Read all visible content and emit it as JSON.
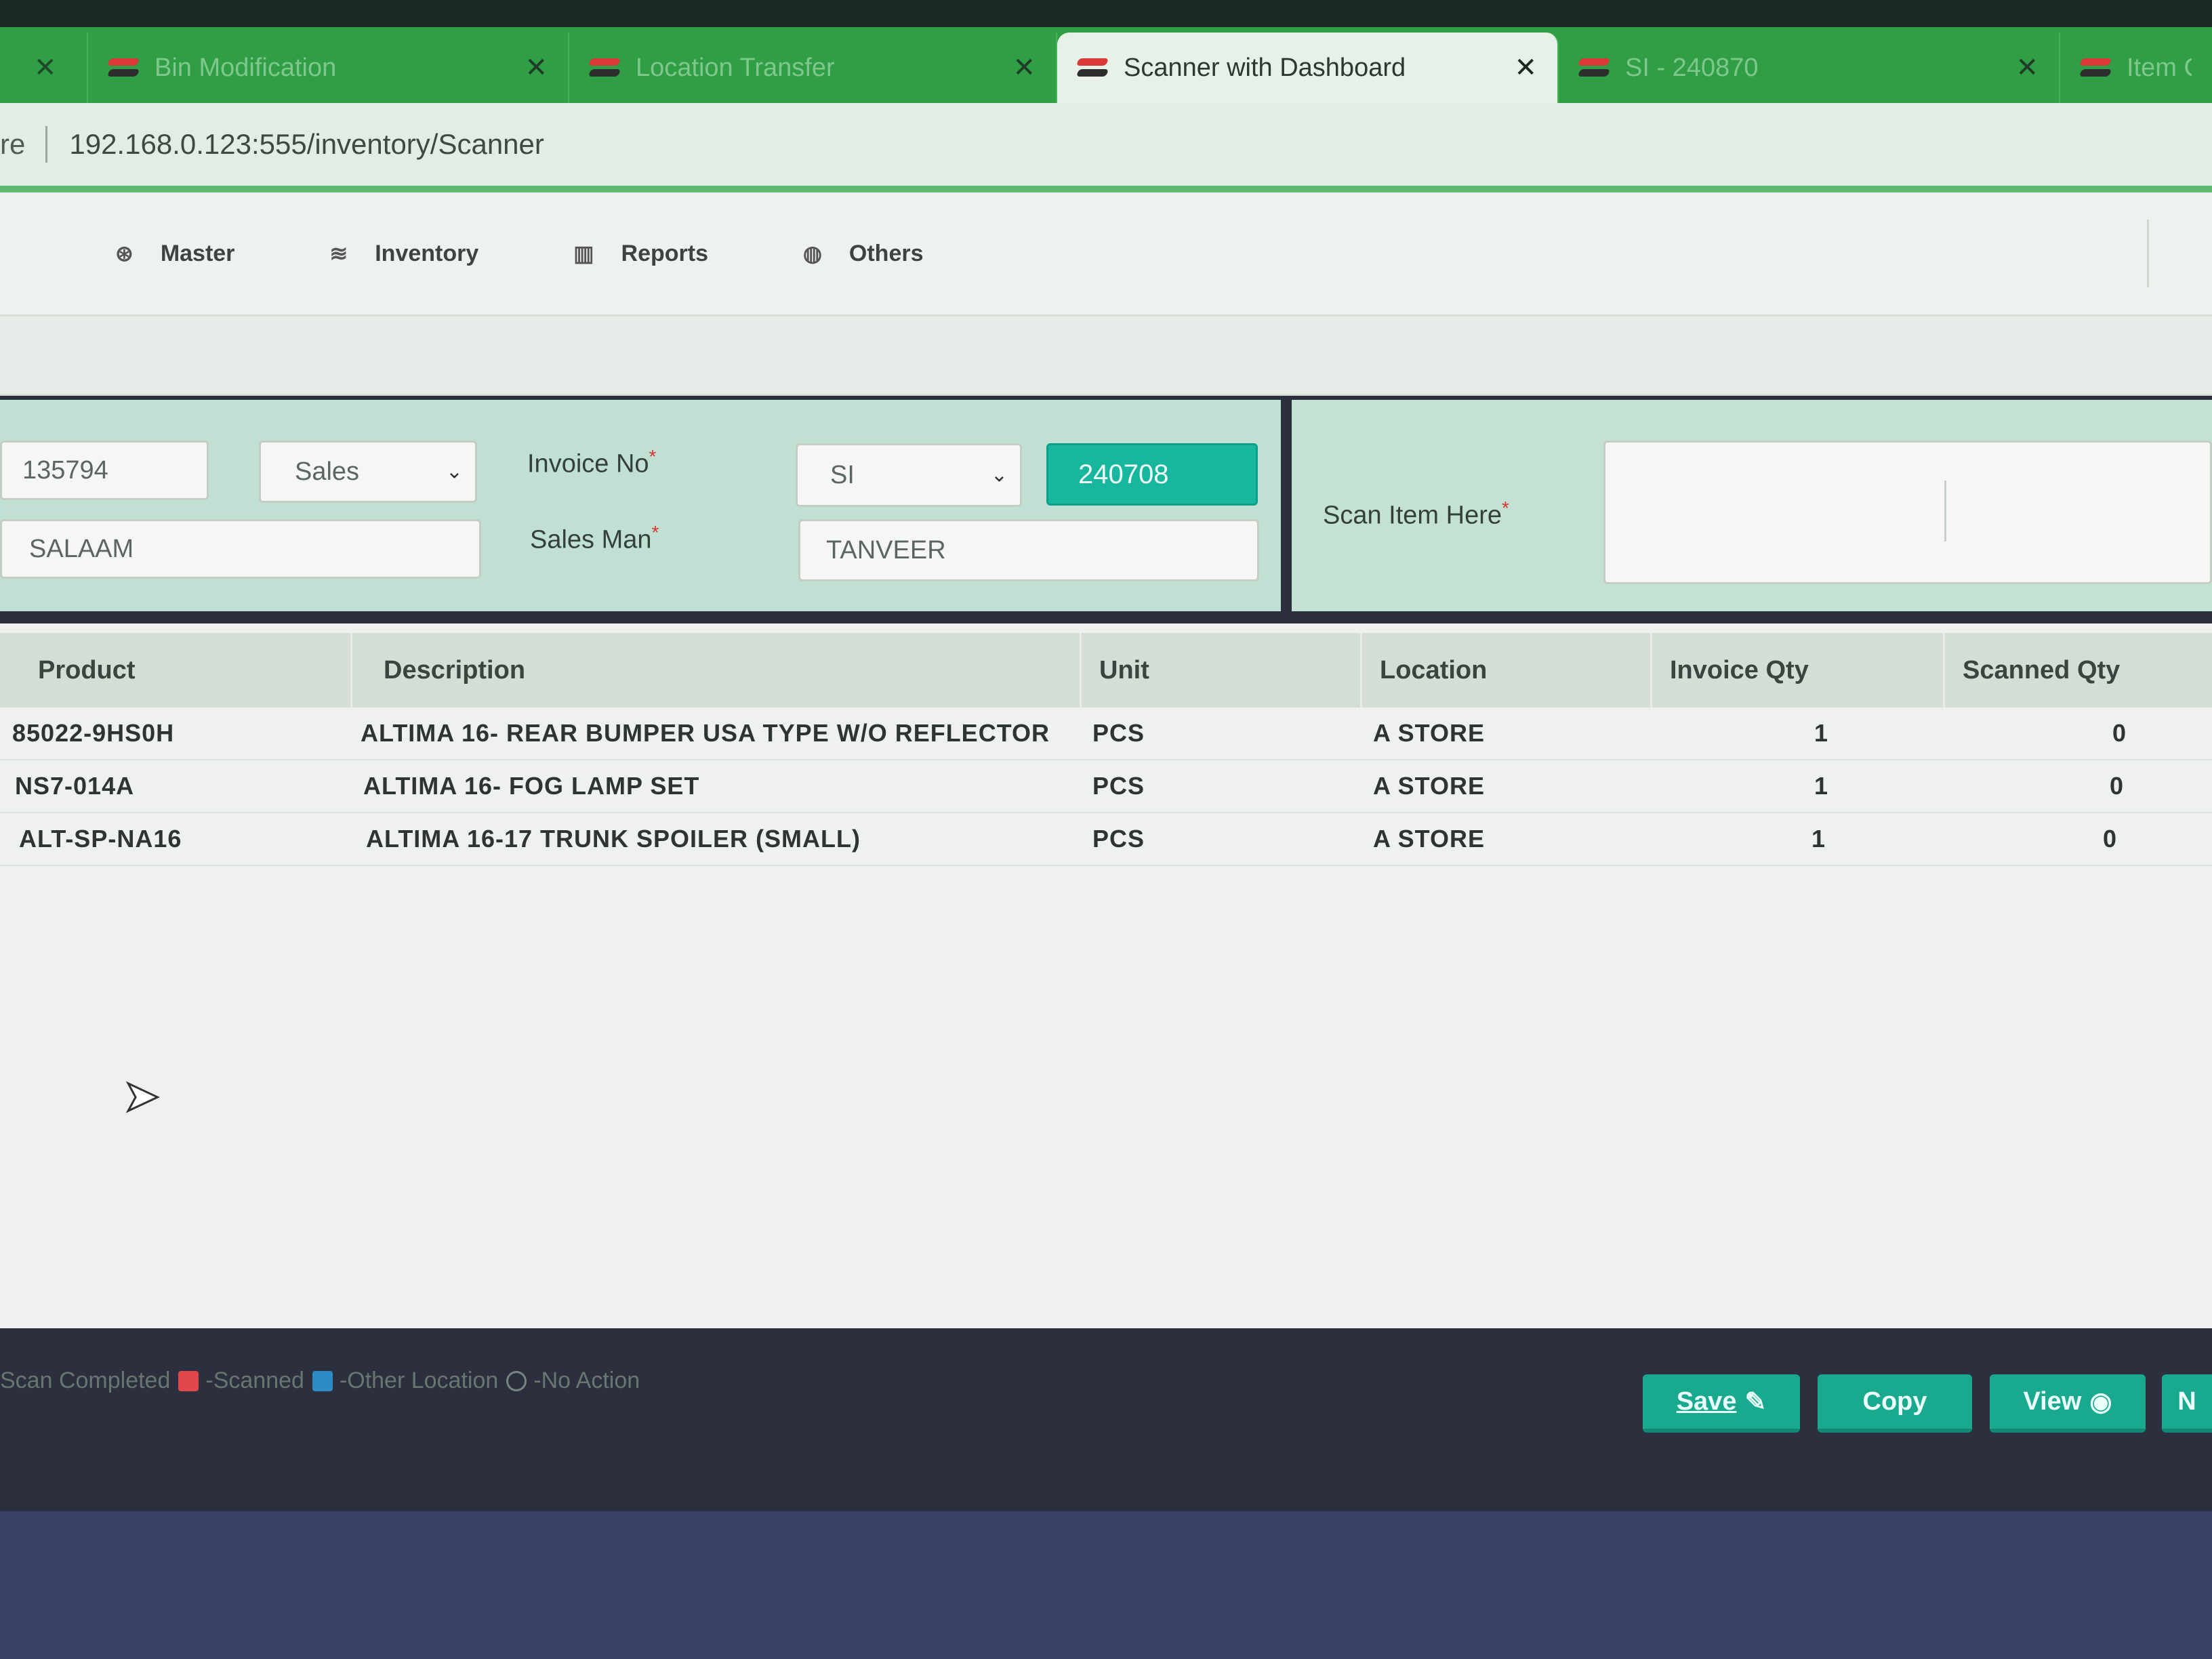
{
  "browser": {
    "tabs": [
      {
        "title": "Bin Modification",
        "faded": true
      },
      {
        "title": "Location Transfer",
        "faded": true
      },
      {
        "title": "Scanner with Dashboard",
        "active": true
      },
      {
        "title": "SI - 240870",
        "faded": true
      },
      {
        "title": "Item C",
        "faded": true
      }
    ],
    "close_glyph": "✕",
    "address": {
      "scheme": "re",
      "url": "192.168.0.123:555/inventory/Scanner"
    }
  },
  "nav": {
    "items": [
      {
        "label": "Master",
        "icon": "cube-icon",
        "glyph": "⊛"
      },
      {
        "label": "Inventory",
        "icon": "database-icon",
        "glyph": "≋"
      },
      {
        "label": "Reports",
        "icon": "bar-chart-icon",
        "glyph": "▥"
      },
      {
        "label": "Others",
        "icon": "globe-icon",
        "glyph": "◍"
      }
    ]
  },
  "form": {
    "customer_code": "135794",
    "type_select": "Sales",
    "customer_name": "SALAAM",
    "invoice_label": "Invoice No",
    "invoice_prefix": "SI",
    "invoice_number": "240708",
    "salesman_label": "Sales Man",
    "salesman_value": "TANVEER",
    "scan_label": "Scan Item Here",
    "scan_value": "",
    "required_mark": "*",
    "caret": "⌄"
  },
  "table": {
    "headers": [
      "Product",
      "Description",
      "Unit",
      "Location",
      "Invoice Qty",
      "Scanned Qty"
    ],
    "rows": [
      {
        "product": "85022-9HS0H",
        "description": "ALTIMA 16- REAR BUMPER USA TYPE W/O REFLECTOR",
        "unit": "PCS",
        "location": "A STORE",
        "invoice_qty": "1",
        "scanned_qty": "0"
      },
      {
        "product": "NS7-014A",
        "description": "ALTIMA 16- FOG LAMP SET",
        "unit": "PCS",
        "location": "A STORE",
        "invoice_qty": "1",
        "scanned_qty": "0"
      },
      {
        "product": "ALT-SP-NA16",
        "description": "ALTIMA 16-17 TRUNK SPOILER (SMALL)",
        "unit": "PCS",
        "location": "A STORE",
        "invoice_qty": "1",
        "scanned_qty": "0"
      }
    ]
  },
  "legend": {
    "completed": "Scan Completed",
    "scanned": "-Scanned",
    "other_location": "-Other Location",
    "no_action": "-No Action"
  },
  "buttons": {
    "save": "Save",
    "save_icon": "✎",
    "copy": "Copy",
    "view": "View",
    "view_icon": "◉",
    "next": "N"
  },
  "colors": {
    "accent": "#18a98f",
    "tab_strip": "#2f9e45",
    "invoice_box": "#16b79e",
    "legend_scanned": "#e0464c",
    "legend_other_location": "#2c8bc4"
  }
}
